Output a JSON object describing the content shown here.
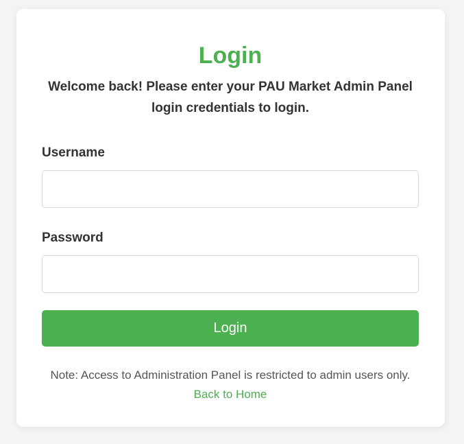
{
  "login_form": {
    "title": "Login",
    "subtitle": "Welcome back! Please enter your PAU Market Admin Panel login credentials to login.",
    "username_label": "Username",
    "username_value": "",
    "password_label": "Password",
    "password_value": "",
    "submit_label": "Login",
    "note": "Note: Access to Administration Panel is restricted to admin users only.",
    "back_link": "Back to Home"
  },
  "colors": {
    "accent": "#4caf50",
    "background": "#f4f4f4",
    "card": "#ffffff",
    "text": "#333333"
  }
}
